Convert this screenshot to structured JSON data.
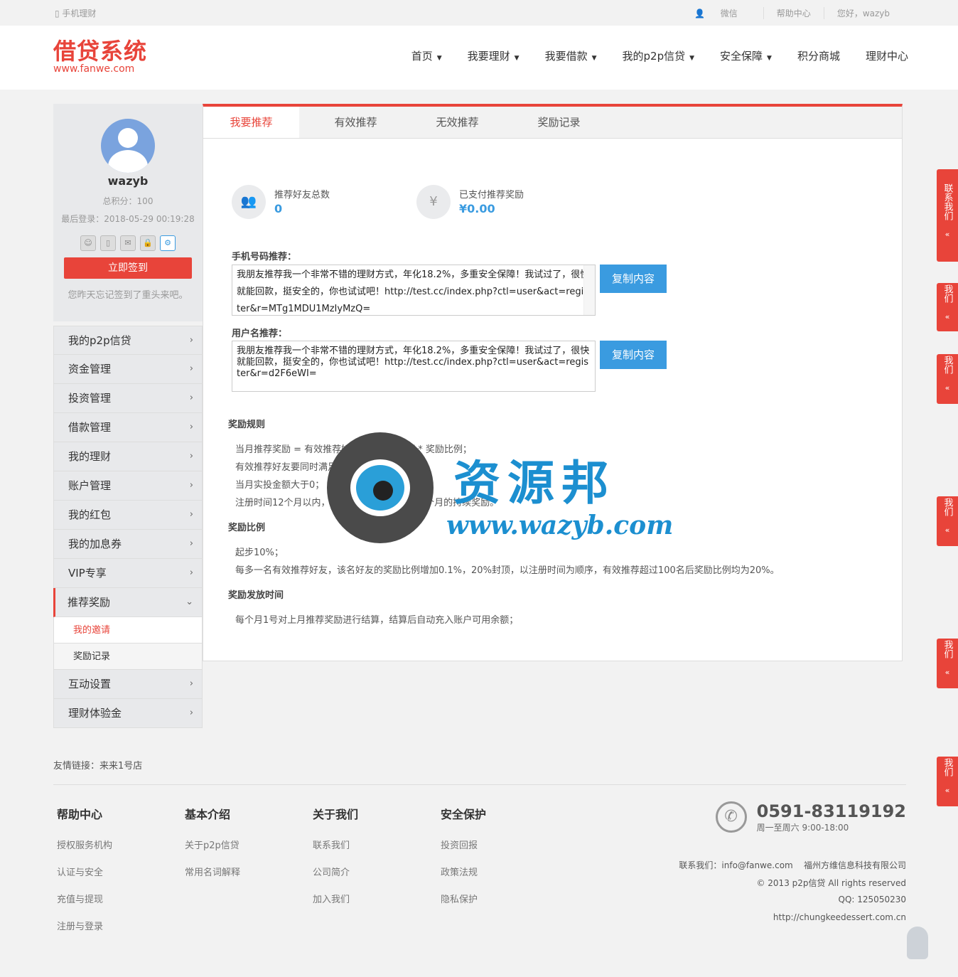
{
  "topbar": {
    "mobile": "手机理财",
    "wechat": "微信",
    "help": "帮助中心",
    "greeting": "您好，wazyb"
  },
  "logo": {
    "cn": "借贷系统",
    "en": "www.fanwe.com"
  },
  "nav": [
    {
      "label": "首页",
      "dd": true
    },
    {
      "label": "我要理财",
      "dd": true
    },
    {
      "label": "我要借款",
      "dd": true
    },
    {
      "label": "我的p2p信贷",
      "dd": true
    },
    {
      "label": "安全保障",
      "dd": true
    },
    {
      "label": "积分商城",
      "dd": false
    },
    {
      "label": "理财中心",
      "dd": false
    }
  ],
  "user": {
    "name": "wazyb",
    "points": "总积分：100",
    "last_login": "最后登录：2018-05-29 00:19:28",
    "sign_btn": "立即签到",
    "sign_tip": "您昨天忘记签到了重头来吧。"
  },
  "menu": [
    {
      "label": "我的p2p信贷"
    },
    {
      "label": "资金管理"
    },
    {
      "label": "投资管理"
    },
    {
      "label": "借款管理"
    },
    {
      "label": "我的理财"
    },
    {
      "label": "账户管理"
    },
    {
      "label": "我的红包"
    },
    {
      "label": "我的加息券"
    },
    {
      "label": "VIP专享"
    },
    {
      "label": "推荐奖励",
      "open": true
    }
  ],
  "submenu": [
    "我的邀请",
    "奖励记录"
  ],
  "menu2": [
    {
      "label": "互动设置"
    },
    {
      "label": "理财体验金"
    }
  ],
  "tabs": [
    "我要推荐",
    "有效推荐",
    "无效推荐",
    "奖励记录"
  ],
  "stats": {
    "friends_label": "推荐好友总数",
    "friends_value": "0",
    "paid_label": "已支付推荐奖励",
    "paid_value": "¥0.00"
  },
  "phone_ref": {
    "label": "手机号码推荐：",
    "text": "我朋友推荐我一个非常不错的理财方式，年化18.2%，多重安全保障！我试过了，很快就能回款，挺安全的，你也试试吧！http://test.cc/index.php?ctl=user&act=register&r=MTg1MDU1MzIyMzQ=",
    "copy": "复制内容"
  },
  "user_ref": {
    "label": "用户名推荐：",
    "text": "我朋友推荐我一个非常不错的理财方式，年化18.2%，多重安全保障！我试过了，很快就能回款，挺安全的，你也试试吧！http://test.cc/index.php?ctl=user&act=register&r=d2F6eWI=",
    "copy": "复制内容"
  },
  "rules": {
    "title": "奖励规则",
    "lines": [
      "当月推荐奖励 = 有效推荐好友当月实投金额 * 奖励比例；",
      "有效推荐好友要同时满足以下条件：",
      "当月实投金额大于0；",
      "注册时间12个月以内，同一次推荐享受长达12个月的持续奖励。"
    ]
  },
  "ratio": {
    "title": "奖励比例",
    "lines": [
      "起步10%；",
      "每多一名有效推荐好友，该名好友的奖励比例增加0.1%，20%封顶，以注册时间为顺序，有效推荐超过100名后奖励比例均为20%。"
    ]
  },
  "payout": {
    "title": "奖励发放时间",
    "lines": [
      "每个月1号对上月推荐奖励进行结算，结算后自动充入账户可用余额；"
    ]
  },
  "watermark": {
    "cn": "资源邦",
    "url": "www.wazyb.com"
  },
  "rtabs": [
    "联系我们",
    "我们",
    "我们",
    "我们",
    "我们",
    "我们"
  ],
  "links": "友情链接：来来1号店",
  "footer": {
    "cols": [
      {
        "h": "帮助中心",
        "items": [
          "授权服务机构",
          "认证与安全",
          "充值与提现",
          "注册与登录"
        ]
      },
      {
        "h": "基本介绍",
        "items": [
          "关于p2p信贷",
          "常用名词解释"
        ]
      },
      {
        "h": "关于我们",
        "items": [
          "联系我们",
          "公司简介",
          "加入我们"
        ]
      },
      {
        "h": "安全保护",
        "items": [
          "投资回报",
          "政策法规",
          "隐私保护"
        ]
      }
    ],
    "phone": "0591-83119192",
    "hours": "周一至周六 9:00-18:00",
    "contact": "联系我们：info@fanwe.com    福州方维信息科技有限公司",
    "copy": "© 2013 p2p信贷 All rights reserved",
    "qq": "QQ:  125050230",
    "url": "http://chungkeedessert.com.cn"
  },
  "colors": {
    "accent": "#e8443a",
    "blue": "#3a9be0"
  }
}
